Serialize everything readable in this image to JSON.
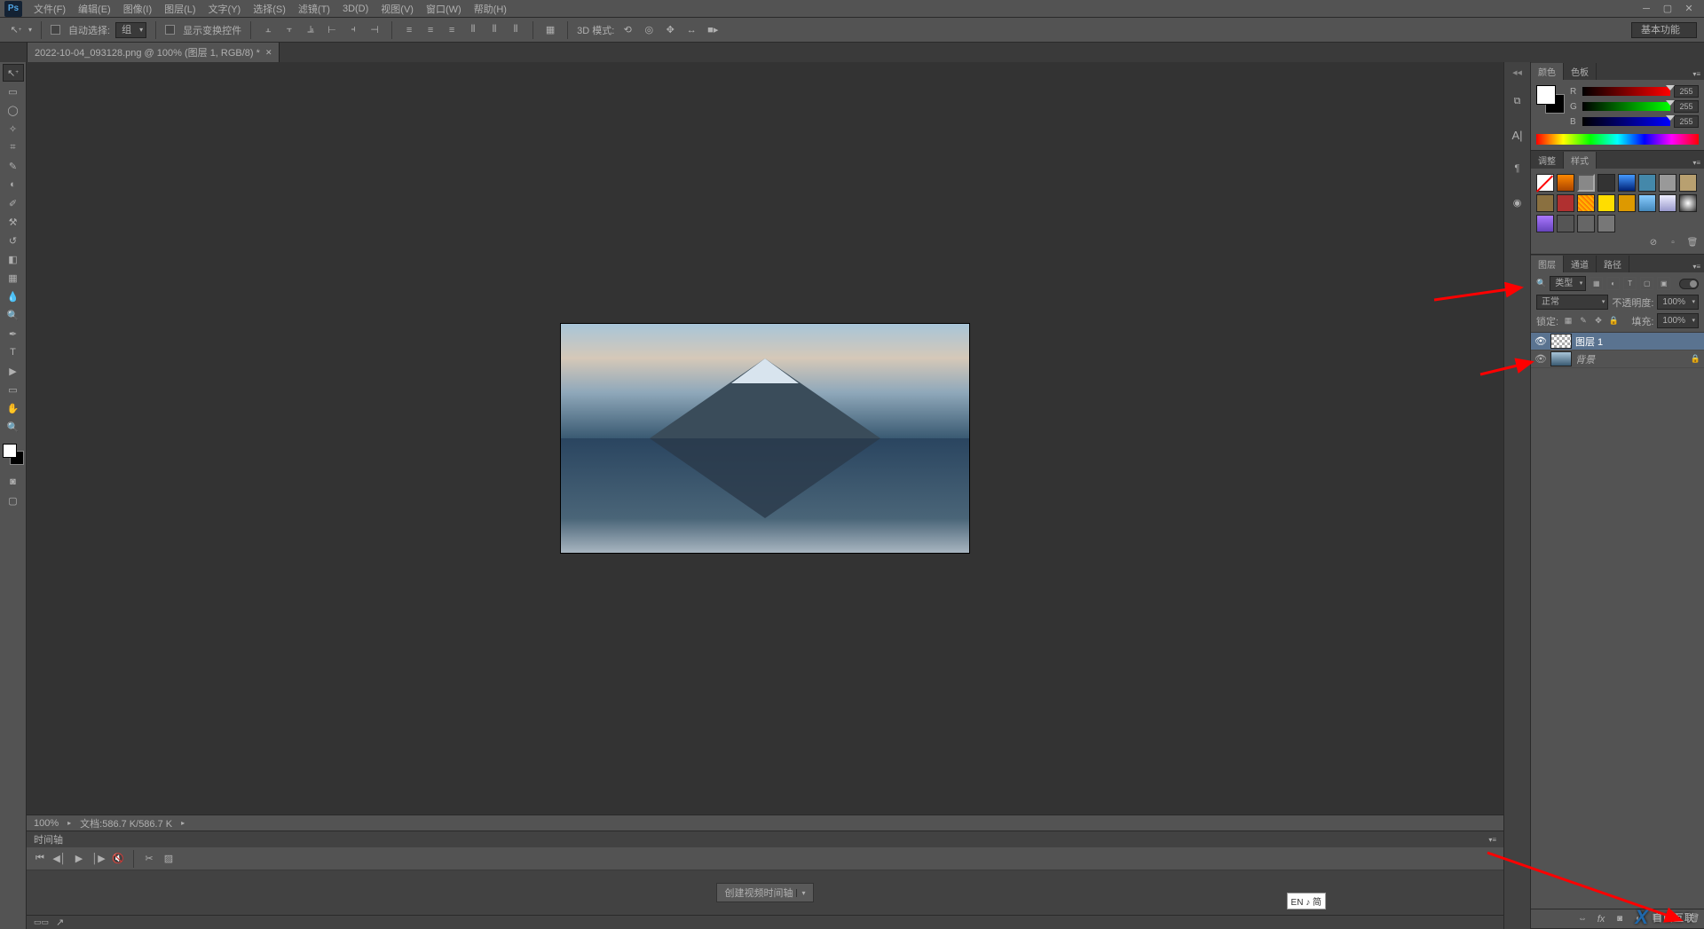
{
  "app": {
    "name": "Ps"
  },
  "menu": [
    "文件(F)",
    "编辑(E)",
    "图像(I)",
    "图层(L)",
    "文字(Y)",
    "选择(S)",
    "滤镜(T)",
    "3D(D)",
    "视图(V)",
    "窗口(W)",
    "帮助(H)"
  ],
  "options": {
    "auto_select_label": "自动选择:",
    "auto_select_mode": "组",
    "show_transform_label": "显示变换控件",
    "mode_3d_label": "3D 模式:"
  },
  "workspace": "基本功能",
  "document_tab": "2022-10-04_093128.png @ 100% (图层 1, RGB/8) *",
  "status": {
    "zoom": "100%",
    "doc_info": "文档:586.7 K/586.7 K"
  },
  "timeline": {
    "title": "时间轴",
    "create_button": "创建视频时间轴"
  },
  "color_panel": {
    "tabs": [
      "颜色",
      "色板"
    ],
    "channels": [
      {
        "label": "R",
        "value": "255"
      },
      {
        "label": "G",
        "value": "255"
      },
      {
        "label": "B",
        "value": "255"
      }
    ]
  },
  "adjustments_panel": {
    "tabs": [
      "调整",
      "样式"
    ]
  },
  "layers_panel": {
    "tabs": [
      "图层",
      "通道",
      "路径"
    ],
    "filter_label": "类型",
    "blend_mode": "正常",
    "opacity_label": "不透明度:",
    "opacity_value": "100%",
    "lock_label": "锁定:",
    "fill_label": "填充:",
    "fill_value": "100%",
    "layers": [
      {
        "name": "图层 1",
        "selected": true,
        "locked": false,
        "thumb": "checker"
      },
      {
        "name": "背景",
        "selected": false,
        "locked": true,
        "thumb": "bg"
      }
    ]
  },
  "ime": "EN ♪ 简",
  "watermark": "自由互联"
}
